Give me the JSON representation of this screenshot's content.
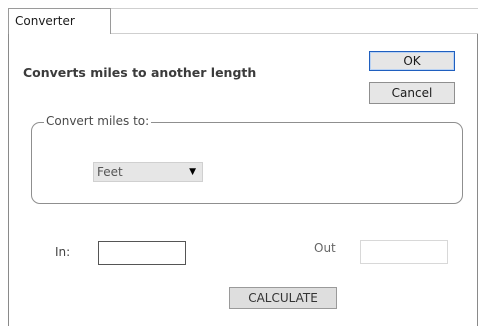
{
  "tabs": [
    {
      "label": "Converter"
    }
  ],
  "heading": "Converts miles to another length",
  "buttons": {
    "ok": "OK",
    "cancel": "Cancel",
    "calculate": "CALCULATE"
  },
  "group": {
    "legend": "Convert miles to:",
    "select": {
      "selected": "Feet"
    }
  },
  "fields": {
    "in_label": "In:",
    "in_value": "",
    "out_label": "Out",
    "out_value": ""
  },
  "colors": {
    "ok_border": "#1f5fbf"
  }
}
